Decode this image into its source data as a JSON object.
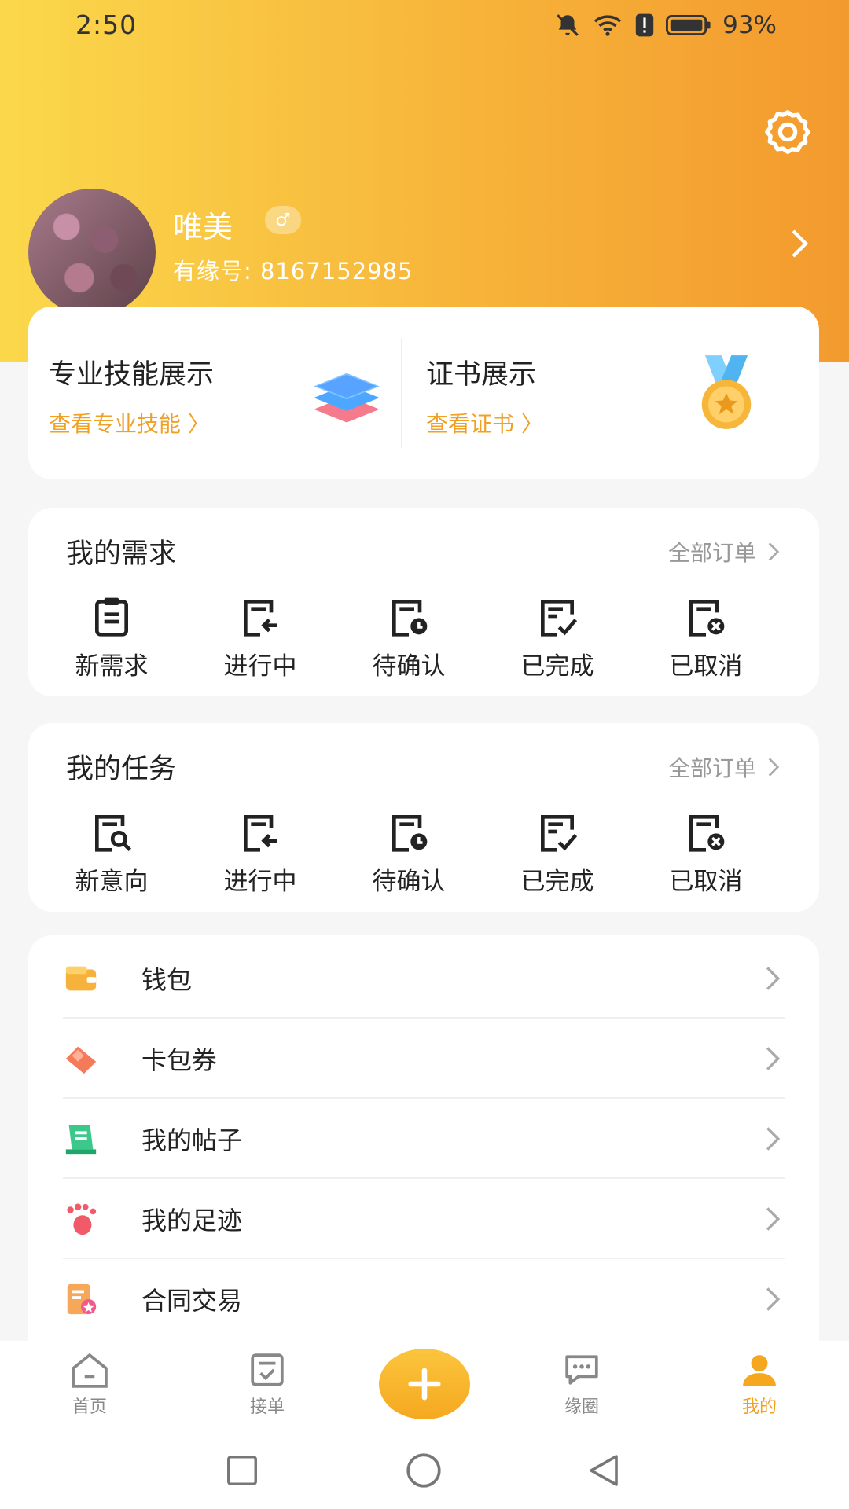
{
  "status_bar": {
    "time": "2:50",
    "battery": "93%"
  },
  "profile": {
    "name": "唯美",
    "id_label": "有缘号: 8167152985"
  },
  "showcase": {
    "skills": {
      "title": "专业技能展示",
      "link": "查看专业技能 〉"
    },
    "certs": {
      "title": "证书展示",
      "link": "查看证书 〉"
    }
  },
  "needs": {
    "title": "我的需求",
    "all": "全部订单",
    "items": [
      {
        "label": "新需求",
        "icon": "clipboard-icon"
      },
      {
        "label": "进行中",
        "icon": "arrow-doc-icon"
      },
      {
        "label": "待确认",
        "icon": "clock-doc-icon"
      },
      {
        "label": "已完成",
        "icon": "check-doc-icon"
      },
      {
        "label": "已取消",
        "icon": "cancel-doc-icon"
      }
    ]
  },
  "tasks": {
    "title": "我的任务",
    "all": "全部订单",
    "items": [
      {
        "label": "新意向",
        "icon": "search-doc-icon"
      },
      {
        "label": "进行中",
        "icon": "arrow-doc-icon"
      },
      {
        "label": "待确认",
        "icon": "clock-doc-icon"
      },
      {
        "label": "已完成",
        "icon": "check-doc-icon"
      },
      {
        "label": "已取消",
        "icon": "cancel-doc-icon"
      }
    ]
  },
  "menu": [
    {
      "label": "钱包",
      "icon": "wallet-icon"
    },
    {
      "label": "卡包券",
      "icon": "ticket-icon"
    },
    {
      "label": "我的帖子",
      "icon": "post-icon"
    },
    {
      "label": "我的足迹",
      "icon": "footprint-icon"
    },
    {
      "label": "合同交易",
      "icon": "contract-icon"
    }
  ],
  "tabs": [
    {
      "label": "首页",
      "icon": "home-icon"
    },
    {
      "label": "接单",
      "icon": "order-icon"
    },
    {
      "label": "缘圈",
      "icon": "chat-icon"
    },
    {
      "label": "我的",
      "icon": "user-icon"
    }
  ],
  "colors": {
    "accent": "#f2a020",
    "header_start": "#fbd84b",
    "header_end": "#f39a2e"
  }
}
